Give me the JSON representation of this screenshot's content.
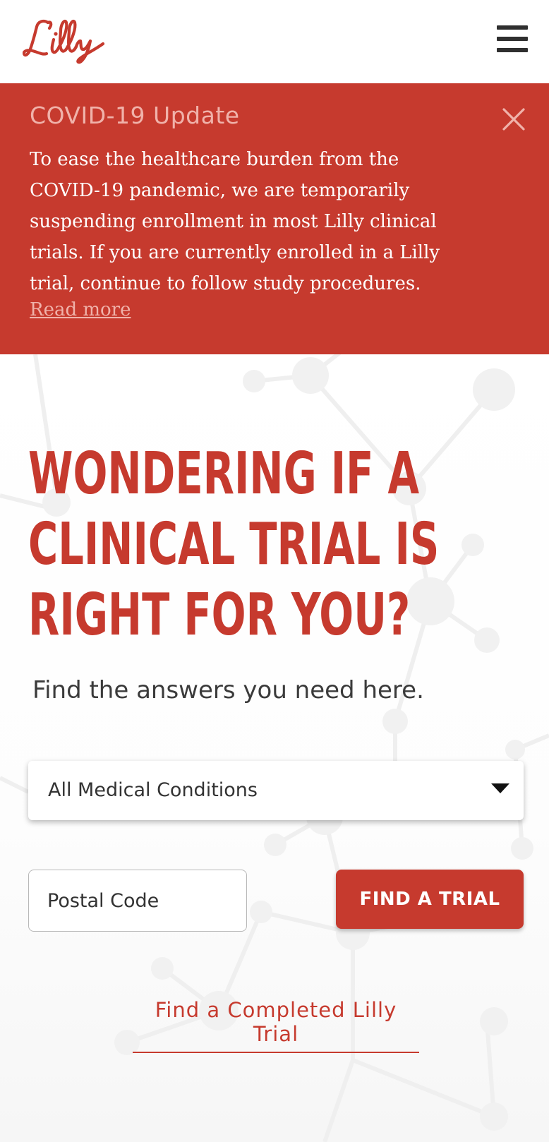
{
  "header": {
    "logo_text": "Lilly",
    "menu_icon": "hamburger-menu-icon"
  },
  "banner": {
    "title": "COVID-19 Update",
    "body": "To ease the healthcare burden from the COVID-19 pandemic, we are temporarily suspending enrollment in most Lilly clinical trials. If you are currently enrolled in a Lilly trial, continue to follow study procedures.",
    "link": "Read more",
    "close_icon": "close-icon"
  },
  "hero": {
    "title": "WONDERING IF A CLINICAL TRIAL IS RIGHT FOR YOU?",
    "subtitle": "Find the answers you need here."
  },
  "search": {
    "condition_selected": "All Medical Conditions",
    "postal_placeholder": "Postal Code",
    "find_button": "FIND A TRIAL"
  },
  "links": {
    "completed_trial": "Find a Completed Lilly Trial"
  },
  "colors": {
    "brand_red": "#c63a2e",
    "banner_title": "#f0b2aa",
    "text_dark": "#3b3b3b"
  }
}
